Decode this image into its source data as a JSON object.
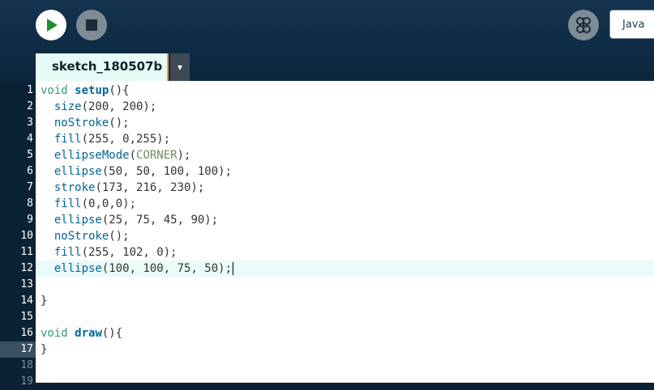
{
  "toolbar": {
    "run_button": "run-icon",
    "stop_button": "stop-icon",
    "mode_button": "debugger-icon",
    "mode_label": "Java"
  },
  "tabs": [
    {
      "label": "sketch_180507b"
    }
  ],
  "tab_menu": "▾",
  "editor": {
    "lines": [
      "void setup(){",
      "  size(200, 200);",
      "  noStroke();",
      "  fill(255, 0,255);",
      "  ellipseMode(CORNER);",
      "  ellipse(50, 50, 100, 100);",
      "  stroke(173, 216, 230);",
      "  fill(0,0,0);",
      "  ellipse(25, 75, 45, 90);",
      "  noStroke();",
      "  fill(255, 102, 0);",
      "  ellipse(100, 100, 75, 50);",
      "",
      "}",
      "",
      "void draw(){",
      "}",
      "",
      ""
    ],
    "line_numbers": [
      "1",
      "2",
      "3",
      "4",
      "5",
      "6",
      "7",
      "8",
      "9",
      "10",
      "11",
      "12",
      "13",
      "14",
      "15",
      "16",
      "17",
      "18",
      "19"
    ],
    "active_line": 12
  },
  "colors": {
    "background": "#0b2236",
    "keyword": "#33997e",
    "function": "#006699",
    "constant": "#718a62",
    "tab_accent": "#ff9a3c"
  }
}
